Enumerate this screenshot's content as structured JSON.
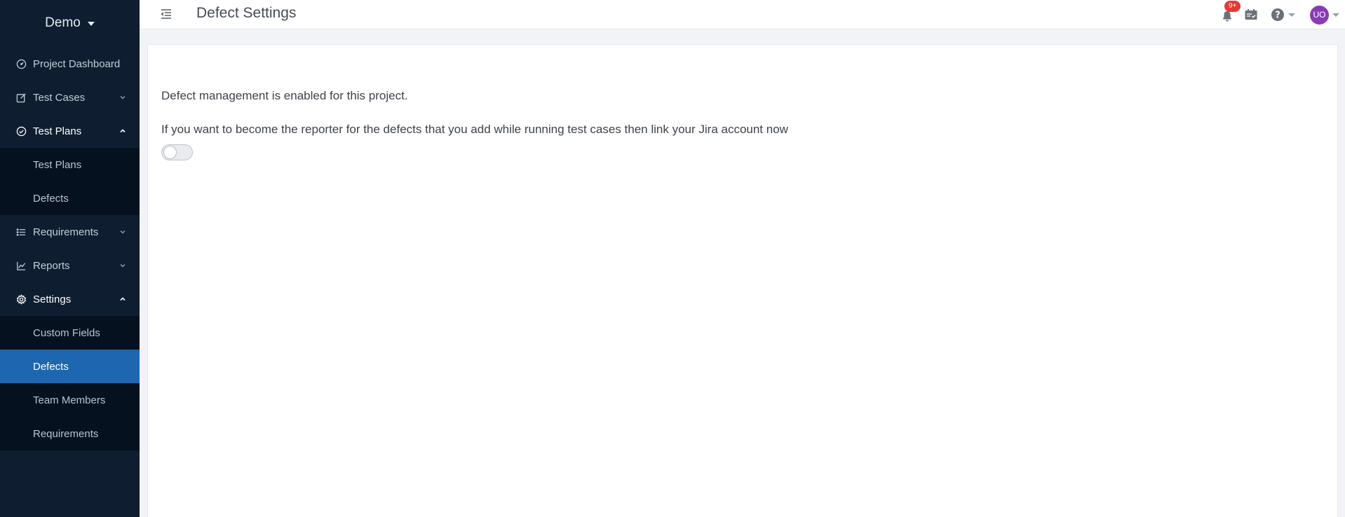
{
  "sidebar": {
    "project": "Demo",
    "items": [
      {
        "label": "Project Dashboard"
      },
      {
        "label": "Test Cases"
      },
      {
        "label": "Test Plans"
      },
      {
        "label": "Requirements"
      },
      {
        "label": "Reports"
      },
      {
        "label": "Settings"
      }
    ],
    "test_plans_sub": [
      "Test Plans",
      "Defects"
    ],
    "settings_sub": [
      "Custom Fields",
      "Defects",
      "Team Members",
      "Requirements"
    ],
    "active_item": "Defects",
    "colors": {
      "background": "#0e1e30",
      "submenu": "#05111e",
      "active": "#1e67b0"
    }
  },
  "topbar": {
    "title": "Defect Settings",
    "notifications_badge": "9+",
    "avatar_initials": "UO",
    "icons": [
      "menu-toggle-icon",
      "bell-icon",
      "calendar-check-icon",
      "help-icon"
    ]
  },
  "main": {
    "status_text": "Defect management is enabled for this project.",
    "jira_prompt": "If you want to become the reporter for the defects that you add while running test cases then link your Jira account now",
    "jira_link_enabled": false
  }
}
